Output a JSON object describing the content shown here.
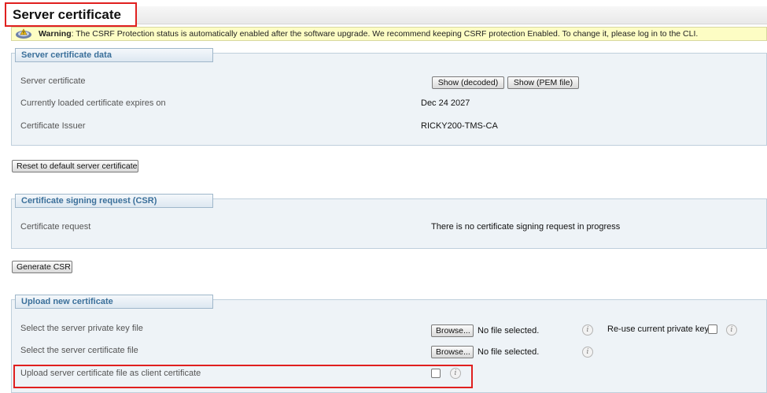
{
  "page": {
    "title": "Server certificate"
  },
  "warning": {
    "label": "Warning",
    "message": ": The CSRF Protection status is automatically enabled after the software upgrade. We recommend keeping CSRF protection Enabled. To change it, please log in to the CLI."
  },
  "server_cert": {
    "legend": "Server certificate data",
    "rows": [
      {
        "label": "Server certificate"
      },
      {
        "label": "Currently loaded certificate expires on",
        "value": "Dec 24 2027"
      },
      {
        "label": "Certificate Issuer",
        "value": "RICKY200-TMS-CA"
      }
    ],
    "show_decoded": "Show (decoded)",
    "show_pem": "Show (PEM file)"
  },
  "reset_button": "Reset to default server certificate",
  "csr": {
    "legend": "Certificate signing request (CSR)",
    "label": "Certificate request",
    "value": "There is no certificate signing request in progress"
  },
  "generate_button": "Generate CSR",
  "upload": {
    "legend": "Upload new certificate",
    "rows": [
      {
        "label": "Select the server private key file",
        "browse": "Browse...",
        "file_status": "No file selected."
      },
      {
        "label": "Select the server certificate file",
        "browse": "Browse...",
        "file_status": "No file selected."
      },
      {
        "label": "Upload server certificate file as client certificate"
      }
    ],
    "reuse_key_label": "Re-use current private key",
    "info_glyph": "i"
  },
  "colors": {
    "highlight": "#e0201f",
    "legend_text": "#3a6f9a",
    "warning_bg": "#fdfdc4",
    "section_bg": "#eef3f7"
  },
  "icons": [
    "warning-icon",
    "info-icon"
  ]
}
